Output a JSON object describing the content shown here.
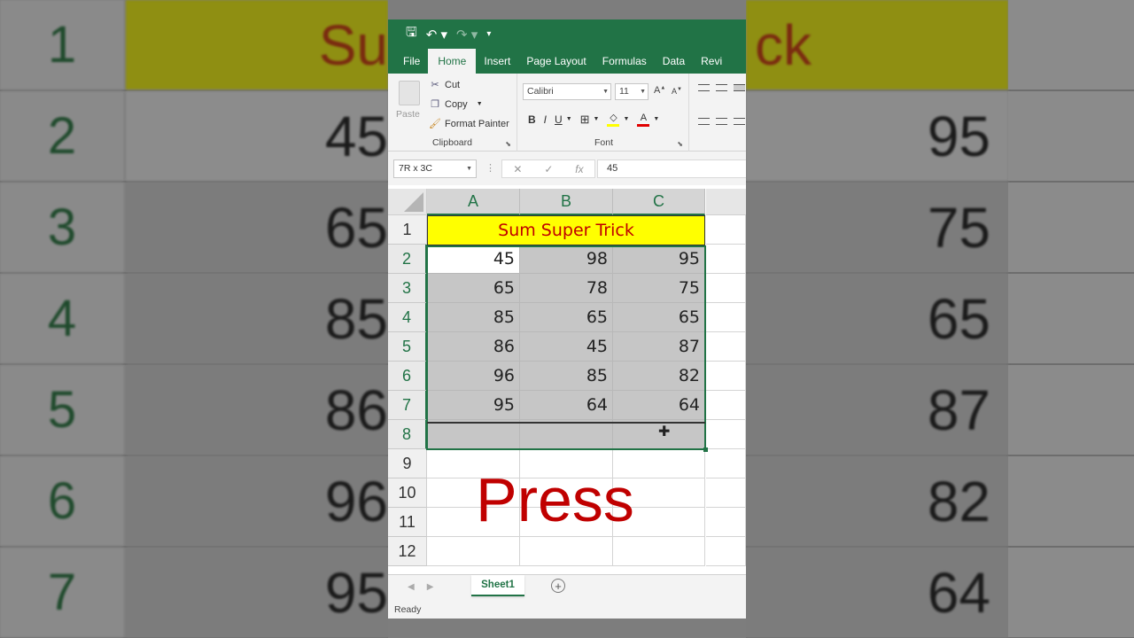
{
  "qat": {
    "save_icon": "save-icon",
    "undo_icon": "undo-icon",
    "redo_icon": "redo-icon",
    "customize_icon": "customize-icon"
  },
  "tabs": [
    "File",
    "Home",
    "Insert",
    "Page Layout",
    "Formulas",
    "Data",
    "Revi"
  ],
  "clipboard": {
    "paste": "Paste",
    "cut": "Cut",
    "copy": "Copy",
    "format_painter": "Format Painter",
    "group": "Clipboard"
  },
  "font": {
    "name": "Calibri",
    "size": "11",
    "bold": "B",
    "italic": "I",
    "underline": "U",
    "group": "Font"
  },
  "formula_bar": {
    "name_box": "7R x 3C",
    "value": "45",
    "cancel": "✕",
    "enter": "✓",
    "fx": "fx"
  },
  "columns": [
    "A",
    "B",
    "C"
  ],
  "rows": [
    "1",
    "2",
    "3",
    "4",
    "5",
    "6",
    "7",
    "8",
    "9",
    "10",
    "11",
    "12"
  ],
  "title": "Sum Super Trick",
  "table": [
    [
      "45",
      "98",
      "95"
    ],
    [
      "65",
      "78",
      "75"
    ],
    [
      "85",
      "65",
      "65"
    ],
    [
      "86",
      "45",
      "87"
    ],
    [
      "96",
      "85",
      "82"
    ],
    [
      "95",
      "64",
      "64"
    ]
  ],
  "overlay_text": "Press",
  "sheet": {
    "tab": "Sheet1",
    "add": "+"
  },
  "status": "Ready",
  "background": {
    "rows": [
      "1",
      "2",
      "3",
      "4",
      "5",
      "6",
      "7"
    ],
    "left_values": [
      "Su",
      "45",
      "65",
      "85",
      "86",
      "96",
      "95"
    ],
    "right_values": [
      "ck",
      "95",
      "75",
      "65",
      "87",
      "82",
      "64"
    ]
  },
  "colors": {
    "excel_green": "#217346",
    "title_fill": "#ffff00",
    "title_text": "#c00000",
    "press_text": "#c00000"
  }
}
